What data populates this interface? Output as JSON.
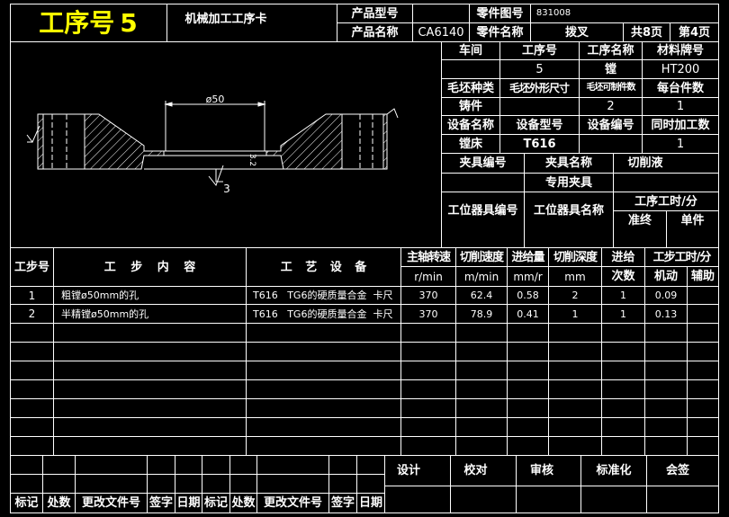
{
  "header": {
    "op_no_label": "工序号",
    "op_no_value": "5",
    "card_title": "机械加工工序卡",
    "product_model_label": "产品型号",
    "part_drawing_label": "零件图号",
    "part_drawing_value": "831008",
    "product_name_label": "产品名称",
    "product_name_value": "CA6140",
    "part_name_label": "零件名称",
    "part_name_value": "拨叉",
    "total_pages": "共8页",
    "page_no": "第4页"
  },
  "info": {
    "workshop_label": "车间",
    "op_no_label": "工序号",
    "op_name_label": "工序名称",
    "material_label": "材料牌号",
    "op_no_value": "5",
    "op_name_value": "镗",
    "material_value": "HT200",
    "blank_type_label": "毛坯种类",
    "blank_size_label": "毛坯外形尺寸",
    "parts_per_blank_label": "毛坯可制件数",
    "parts_per_unit_label": "每台件数",
    "blank_type_value": "铸件",
    "parts_per_blank_value": "2",
    "parts_per_unit_value": "1",
    "equip_name_label": "设备名称",
    "equip_model_label": "设备型号",
    "equip_no_label": "设备编号",
    "simultaneous_label": "同时加工数",
    "equip_name_value": "镗床",
    "equip_model_value": "T616",
    "simultaneous_value": "1",
    "fixture_no_label": "夹具编号",
    "fixture_name_label": "夹具名称",
    "coolant_label": "切削液",
    "fixture_name_value": "专用夹具",
    "station_tool_no_label": "工位器具编号",
    "station_tool_name_label": "工位器具名称",
    "op_time_label": "工序工时/分",
    "prep_label": "准终",
    "unit_label": "单件"
  },
  "drawing": {
    "dim_diameter": "ø50",
    "roughness_a": "3.2",
    "roughness_b": "3"
  },
  "steps_table": {
    "headers": {
      "step_no": "工步号",
      "content": "工 步 内 容",
      "equipment": "工 艺 设 备",
      "spindle": "主轴转速",
      "cut_speed": "切削速度",
      "feed": "进给量",
      "depth": "切削深度",
      "passes_a": "进给",
      "passes_b": "次数",
      "step_time": "工步工时/分",
      "machine": "机动",
      "aux": "辅助",
      "u_spindle": "r/min",
      "u_speed": "m/min",
      "u_feed": "mm/r",
      "u_depth": "mm"
    },
    "rows": [
      {
        "no": "1",
        "content": "粗镗ø50mm的孔",
        "equip": "T616   TG6的硬质量合金  卡尺",
        "spindle": "370",
        "speed": "62.4",
        "feed": "0.58",
        "depth": "2",
        "passes": "1",
        "machine": "0.09",
        "aux": ""
      },
      {
        "no": "2",
        "content": "半精镗ø50mm的孔",
        "equip": "T616   TG6的硬质量合金  卡尺",
        "spindle": "370",
        "speed": "78.9",
        "feed": "0.41",
        "depth": "1",
        "passes": "1",
        "machine": "0.13",
        "aux": ""
      }
    ]
  },
  "footer": {
    "design": "设计",
    "check": "校对",
    "review": "审核",
    "standard": "标准化",
    "sign": "会签",
    "mark": "标记",
    "count": "处数",
    "change_doc": "更改文件号",
    "signature": "签字",
    "date": "日期"
  }
}
